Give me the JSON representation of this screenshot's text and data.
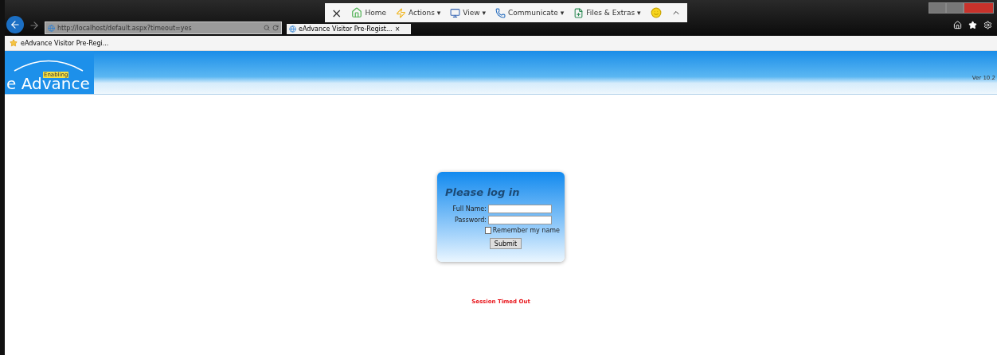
{
  "browser": {
    "address": "http://localhost/default.aspx?timeout=yes",
    "tab": {
      "label": "eAdvance Visitor Pre-Regist...",
      "close": "×",
      "selected": true
    },
    "toolbar": [
      {
        "kind": "close",
        "label": "×"
      },
      {
        "kind": "home",
        "label": "Home"
      },
      {
        "kind": "menu",
        "label": "Actions",
        "arrow": "▾"
      },
      {
        "kind": "menu",
        "label": "View",
        "arrow": "▾"
      },
      {
        "kind": "menu",
        "label": "Communicate",
        "arrow": "▾"
      },
      {
        "kind": "menu",
        "label": "Files & Extras",
        "arrow": "▾"
      },
      {
        "kind": "smiley"
      }
    ],
    "favorite": "eAdvance Visitor Pre-Regi..."
  },
  "header": {
    "logo": "e Advance",
    "badge": "Enabling",
    "version": "Ver 10.2"
  },
  "login": {
    "title": "Please log in",
    "fields": [
      {
        "label": "Full Name:"
      },
      {
        "label": "Password:"
      }
    ],
    "remember": {
      "label": "Remember my name",
      "checked": false
    },
    "submit": "Submit"
  },
  "message": "Session Timed Out"
}
